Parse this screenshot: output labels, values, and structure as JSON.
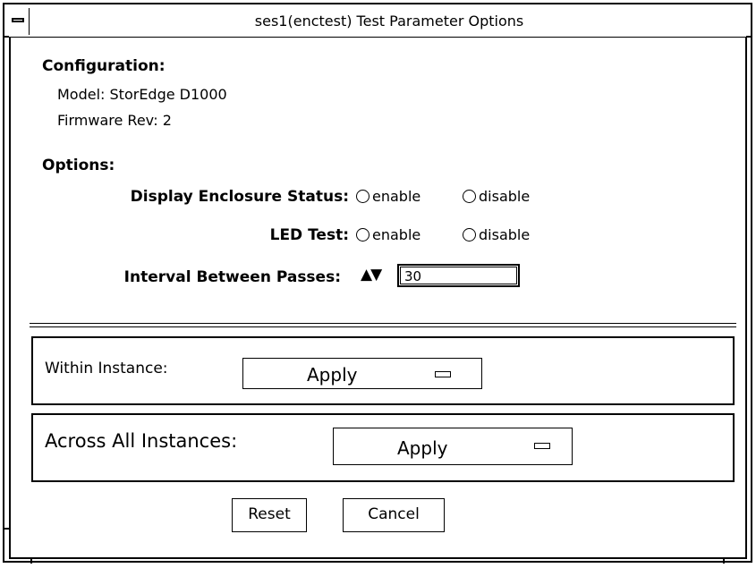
{
  "window": {
    "title": "ses1(enctest) Test Parameter Options"
  },
  "configuration": {
    "heading": "Configuration:",
    "model": "Model: StorEdge D1000",
    "firmware": "Firmware Rev: 2"
  },
  "options": {
    "heading": "Options:",
    "display_enclosure_status": {
      "label": "Display Enclosure Status:",
      "enable": "enable",
      "disable": "disable"
    },
    "led_test": {
      "label": "LED Test:",
      "enable": "enable",
      "disable": "disable"
    },
    "interval": {
      "label": "Interval Between Passes:",
      "arrows": "▲▼",
      "value": "30"
    }
  },
  "within_instance": {
    "label": "Within Instance:",
    "button": "Apply"
  },
  "across_instances": {
    "label": "Across All Instances:",
    "button": "Apply"
  },
  "footer": {
    "reset": "Reset",
    "cancel": "Cancel"
  }
}
